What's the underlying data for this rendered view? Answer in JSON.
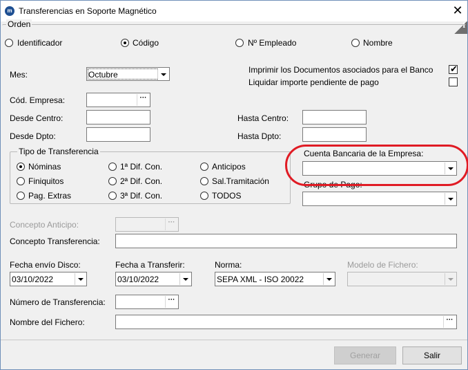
{
  "window": {
    "title": "Transferencias en Soporte Magnético",
    "app_icon_text": "m"
  },
  "orden": {
    "title": "Orden",
    "options": [
      {
        "label": "Identificador",
        "selected": false
      },
      {
        "label": "Código",
        "selected": true
      },
      {
        "label": "Nº Empleado",
        "selected": false
      },
      {
        "label": "Nombre",
        "selected": false
      }
    ]
  },
  "mes": {
    "label": "Mes:",
    "value": "Octubre"
  },
  "checks": [
    {
      "label": "Imprimir los Documentos asociados para el Banco",
      "checked": true
    },
    {
      "label": "Liquidar importe pendiente de pago",
      "checked": false
    }
  ],
  "cod_empresa": {
    "label": "Cód. Empresa:",
    "value": ""
  },
  "desde_centro": {
    "label": "Desde Centro:",
    "value": ""
  },
  "hasta_centro": {
    "label": "Hasta Centro:",
    "value": ""
  },
  "desde_dpto": {
    "label": "Desde Dpto:",
    "value": ""
  },
  "hasta_dpto": {
    "label": "Hasta Dpto:",
    "value": ""
  },
  "tipo": {
    "title": "Tipo de Transferencia",
    "options": [
      {
        "label": "Nóminas",
        "selected": true
      },
      {
        "label": "Finiquitos",
        "selected": false
      },
      {
        "label": "Pag. Extras",
        "selected": false
      },
      {
        "label": "1ª Dif. Con.",
        "selected": false
      },
      {
        "label": "2ª Dif. Con.",
        "selected": false
      },
      {
        "label": "3ª Dif. Con.",
        "selected": false
      },
      {
        "label": "Anticipos",
        "selected": false
      },
      {
        "label": "Sal.Tramitación",
        "selected": false
      },
      {
        "label": "TODOS",
        "selected": false
      }
    ]
  },
  "cuenta_bancaria": {
    "label": "Cuenta Bancaria de la Empresa:",
    "value": ""
  },
  "grupo_pago": {
    "label": "Grupo de Pago:",
    "value": ""
  },
  "concepto_anticipo": {
    "label": "Concepto Anticipo:",
    "value": ""
  },
  "concepto_transferencia": {
    "label": "Concepto Transferencia:",
    "value": ""
  },
  "fecha_envio": {
    "label": "Fecha envío Disco:",
    "value": "03/10/2022"
  },
  "fecha_transferir": {
    "label": "Fecha a Transferir:",
    "value": "03/10/2022"
  },
  "norma": {
    "label": "Norma:",
    "value": "SEPA XML - ISO 20022"
  },
  "modelo_fichero": {
    "label": "Modelo de Fichero:",
    "value": ""
  },
  "numero_transferencia": {
    "label": "Número de Transferencia:",
    "value": ""
  },
  "nombre_fichero": {
    "label": "Nombre del Fichero:",
    "value": ""
  },
  "buttons": {
    "generar": "Generar",
    "salir": "Salir"
  },
  "colors": {
    "annotation": "#e01b24",
    "window_border": "#6f8fb8",
    "background": "#f0f0f0"
  },
  "icons": [
    "app-icon",
    "close-icon",
    "info-icon",
    "ellipsis-icon",
    "chevron-down-icon",
    "checkmark-icon"
  ]
}
